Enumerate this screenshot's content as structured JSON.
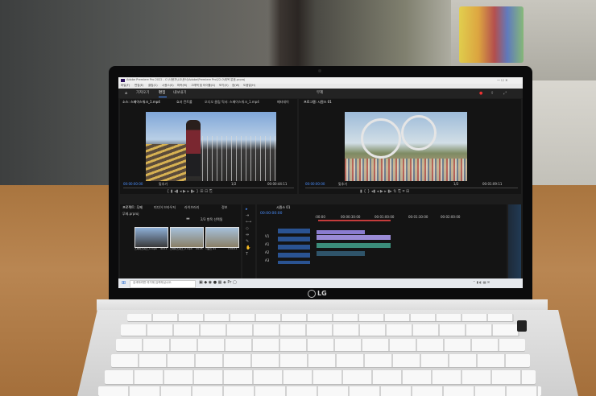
{
  "app": {
    "title": "Adobe Premiere Pro 2022 - C:\\사용자\\LG\\문서\\Adobe\\Premiere Pro\\22.0\\제목 없음.prproj"
  },
  "menu": [
    "파일(F)",
    "편집(E)",
    "클립(C)",
    "시퀀스(S)",
    "마커(M)",
    "그래픽 및 타이틀(G)",
    "보기(V)",
    "창(W)",
    "도움말(H)"
  ],
  "workspace_tabs": [
    "가져오기",
    "편집",
    "내보내기"
  ],
  "active_workspace": "편집",
  "header_center": "무제",
  "source_panel": {
    "tabs": [
      "소스: 스페이스워크_1.mp4",
      "효과 컨트롤",
      "오디오 클립 믹서: 스페이스워크_1.mp4",
      "메타데이"
    ],
    "timecode_in": "00:00:00:00",
    "fit": "맞추기",
    "ratio": "1/2",
    "timecode_out": "00:00:44:11"
  },
  "program_panel": {
    "title": "프로그램: 시퀀스 01",
    "timecode_in": "00:00:00:00",
    "fit": "맞추기",
    "ratio": "1/2",
    "timecode_out": "00:01:09:11"
  },
  "project_panel": {
    "tabs": [
      "프로젝트: 무제",
      "미디어 브라우저",
      "라이브러리",
      "정보"
    ],
    "file": "무제.prproj",
    "selection": "2/3 항목 선택됨",
    "clips": [
      "스페이스워크_1.mp4",
      "스페이스워크_2.mp4",
      "시퀀스 01"
    ],
    "durations": [
      "44:11",
      "24:25",
      "1:09:11"
    ]
  },
  "timeline": {
    "tab": "시퀀스 01",
    "timecode": "00:00:00:00",
    "ruler": [
      ":00:00",
      "00:00:30:00",
      "00:01:00:00",
      "00:01:30:00",
      "00:02:00:00"
    ],
    "tracks": [
      "V1",
      "A1",
      "A2",
      "A3"
    ]
  },
  "taskbar": {
    "search_placeholder": "검색하려면 여기에 입력하십시오."
  },
  "logo": "LG"
}
